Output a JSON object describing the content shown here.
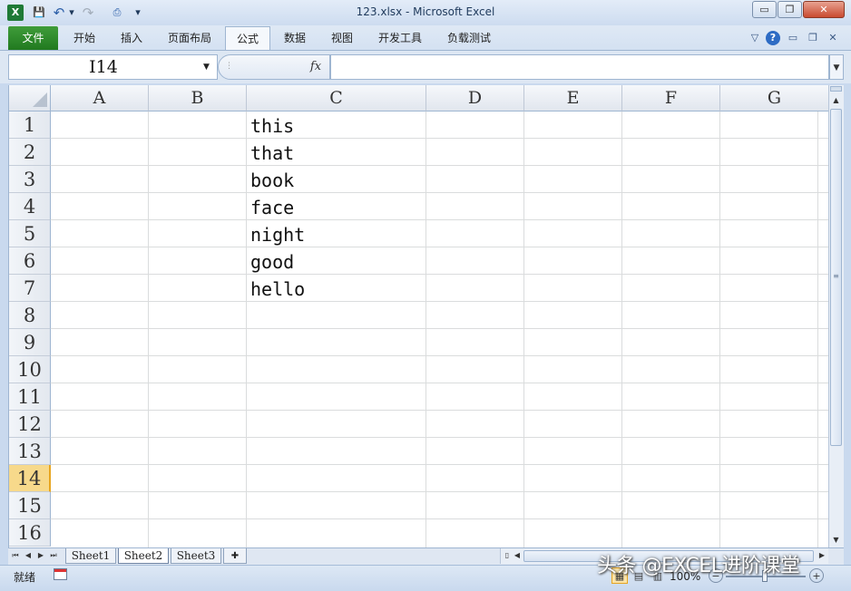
{
  "window": {
    "title": "123.xlsx - Microsoft Excel",
    "minimize": "▭",
    "restore": "❐",
    "close": "✕"
  },
  "quick_access": {
    "app_icon": "X",
    "save_icon": "💾",
    "undo_icon": "↶",
    "redo_icon": "↷",
    "dropdown": "▾"
  },
  "ribbon": {
    "tabs": [
      {
        "label": "文件"
      },
      {
        "label": "开始"
      },
      {
        "label": "插入"
      },
      {
        "label": "页面布局"
      },
      {
        "label": "公式"
      },
      {
        "label": "数据"
      },
      {
        "label": "视图"
      },
      {
        "label": "开发工具"
      },
      {
        "label": "负载测试"
      }
    ],
    "active_tab": "公式",
    "help_icon": "?",
    "collapse_icon": "♡"
  },
  "formula_bar": {
    "name_box": "I14",
    "fx_label": "fx",
    "formula": ""
  },
  "grid": {
    "columns": [
      "A",
      "B",
      "C",
      "D",
      "E",
      "F",
      "G"
    ],
    "rows": [
      "1",
      "2",
      "3",
      "4",
      "5",
      "6",
      "7",
      "8",
      "9",
      "10",
      "11",
      "12",
      "13",
      "14",
      "15",
      "16"
    ],
    "active_row": "14",
    "column_c_values": [
      "this",
      "that",
      "book",
      "face",
      "night",
      "good",
      "hello"
    ]
  },
  "sheets": {
    "tabs": [
      "Sheet1",
      "Sheet2",
      "Sheet3"
    ],
    "active": "Sheet2"
  },
  "status_bar": {
    "status": "就绪",
    "zoom": "100%",
    "zoom_minus": "−",
    "zoom_plus": "+"
  },
  "watermark": "头条 @EXCEL进阶课堂",
  "colors": {
    "file_tab": "#217a1f",
    "active_row_header": "#f7d98b",
    "grid_line": "#dadcdd"
  }
}
